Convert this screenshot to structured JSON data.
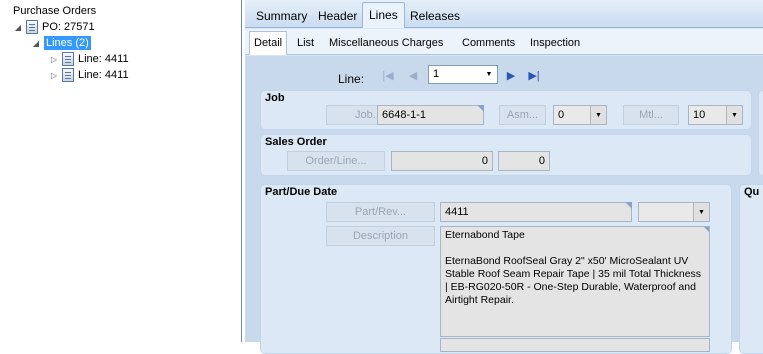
{
  "tree": {
    "root": "Purchase Orders",
    "po": "PO: 27571",
    "lines": "Lines (2)",
    "line_items": [
      "Line: 4411",
      "Line: 4411"
    ]
  },
  "tabs": [
    "Summary",
    "Header",
    "Lines",
    "Releases"
  ],
  "active_tab": "Lines",
  "subtabs": [
    "Detail",
    "List",
    "Miscellaneous Charges",
    "Comments",
    "Inspection"
  ],
  "active_subtab": "Detail",
  "line_nav": {
    "label": "Line:",
    "value": "1"
  },
  "job": {
    "title": "Job",
    "job_button": "Job...",
    "job_value": "6648-1-1",
    "asm_button": "Asm...",
    "asm_value": "0",
    "mtl_button": "Mtl...",
    "mtl_value": "10"
  },
  "sales_order": {
    "title": "Sales Order",
    "order_button": "Order/Line...",
    "order_value": "0",
    "line_value": "0"
  },
  "part": {
    "title": "Part/Due Date",
    "partrev_button": "Part/Rev...",
    "part_value": "4411",
    "rev_value": "",
    "description_button": "Description",
    "description_value": "Eternabond Tape\n\nEternaBond RoofSeal Gray 2\" x50' MicroSealant UV Stable Roof Seam Repair Tape | 35 mil Total Thickness | EB-RG020-50R - One-Step Durable, Waterproof and Airtight Repair."
  },
  "qty_title_partial": "Qu",
  "colors": {
    "selected": "#3399ff",
    "nav_enabled": "#2a56b8",
    "panel_bg": "#c9d9ec"
  }
}
